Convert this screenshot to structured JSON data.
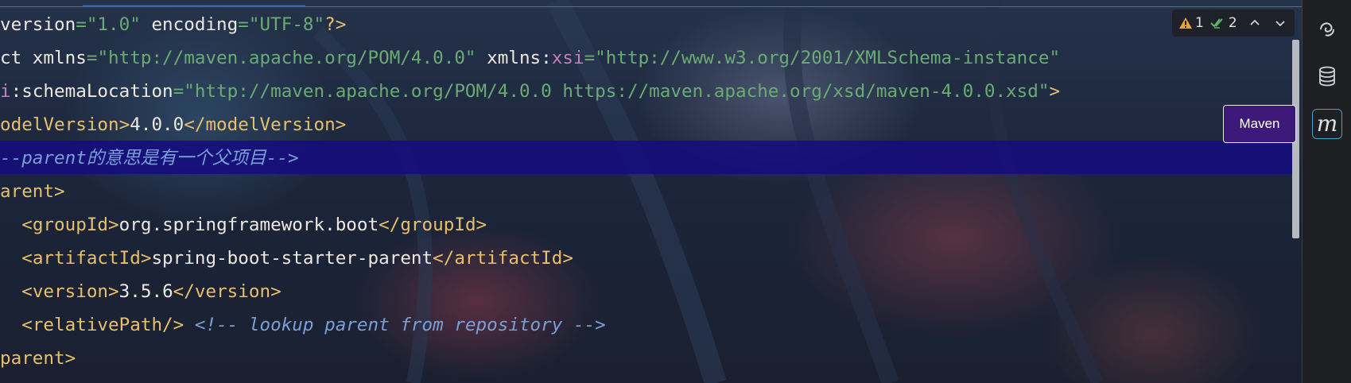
{
  "editor": {
    "lines": [
      [
        {
          "t": "version",
          "c": "txt"
        },
        {
          "t": "=",
          "c": "str"
        },
        {
          "t": "\"1.0\"",
          "c": "str"
        },
        {
          "t": " encoding",
          "c": "txt"
        },
        {
          "t": "=",
          "c": "str"
        },
        {
          "t": "\"UTF-8\"",
          "c": "str"
        },
        {
          "t": "?>",
          "c": "tag"
        }
      ],
      [
        {
          "t": "ct xmlns",
          "c": "txt"
        },
        {
          "t": "=",
          "c": "str"
        },
        {
          "t": "\"http://maven.apache.org/POM/4.0.0\"",
          "c": "str"
        },
        {
          "t": " xmlns:",
          "c": "txt"
        },
        {
          "t": "xsi",
          "c": "xsi"
        },
        {
          "t": "=",
          "c": "str"
        },
        {
          "t": "\"http://www.w3.org/2001/XMLSchema-instance\"",
          "c": "str"
        }
      ],
      [
        {
          "t": "i",
          "c": "xsi"
        },
        {
          "t": ":schemaLocation",
          "c": "txt"
        },
        {
          "t": "=",
          "c": "str"
        },
        {
          "t": "\"http://maven.apache.org/POM/4.0.0 https://maven.apache.org/xsd/maven-4.0.0.xsd\"",
          "c": "str"
        },
        {
          "t": ">",
          "c": "tag"
        }
      ],
      [
        {
          "t": "odelVersion>",
          "c": "tag"
        },
        {
          "t": "4.0.0",
          "c": "txt"
        },
        {
          "t": "</modelVersion>",
          "c": "tag"
        }
      ],
      [
        {
          "t": "--parent的意思是有一个父项目-->",
          "c": "cmt"
        }
      ],
      [
        {
          "t": "arent>",
          "c": "tag"
        }
      ],
      [
        {
          "t": "  ",
          "c": "txt"
        },
        {
          "t": "<groupId>",
          "c": "tag"
        },
        {
          "t": "org.springframework.boot",
          "c": "txt"
        },
        {
          "t": "</groupId>",
          "c": "tag"
        }
      ],
      [
        {
          "t": "  ",
          "c": "txt"
        },
        {
          "t": "<artifactId>",
          "c": "tag"
        },
        {
          "t": "spring-boot-starter-parent",
          "c": "txt"
        },
        {
          "t": "</artifactId>",
          "c": "tag"
        }
      ],
      [
        {
          "t": "  ",
          "c": "txt"
        },
        {
          "t": "<version>",
          "c": "tag"
        },
        {
          "t": "3.5.6",
          "c": "txt"
        },
        {
          "t": "</version>",
          "c": "tag"
        }
      ],
      [
        {
          "t": "  ",
          "c": "txt"
        },
        {
          "t": "<relativePath/>",
          "c": "tag"
        },
        {
          "t": " ",
          "c": "txt"
        },
        {
          "t": "<!-- lookup parent from repository -->",
          "c": "cmt"
        }
      ],
      [
        {
          "t": "parent>",
          "c": "tag"
        }
      ]
    ]
  },
  "inspections": {
    "warnings": "1",
    "checks": "2"
  },
  "tooltip": {
    "label": "Maven"
  },
  "right_rail": {
    "icons": [
      "ai-assistant-icon",
      "database-icon",
      "maven-icon"
    ],
    "maven_glyph": "m"
  },
  "colors": {
    "tag": "#e8bf6a",
    "string": "#6aab73",
    "namespace": "#c77dbb",
    "comment": "#7a9fd6",
    "highlight": "#140a82",
    "tooltip_bg": "#3d1a7a"
  }
}
